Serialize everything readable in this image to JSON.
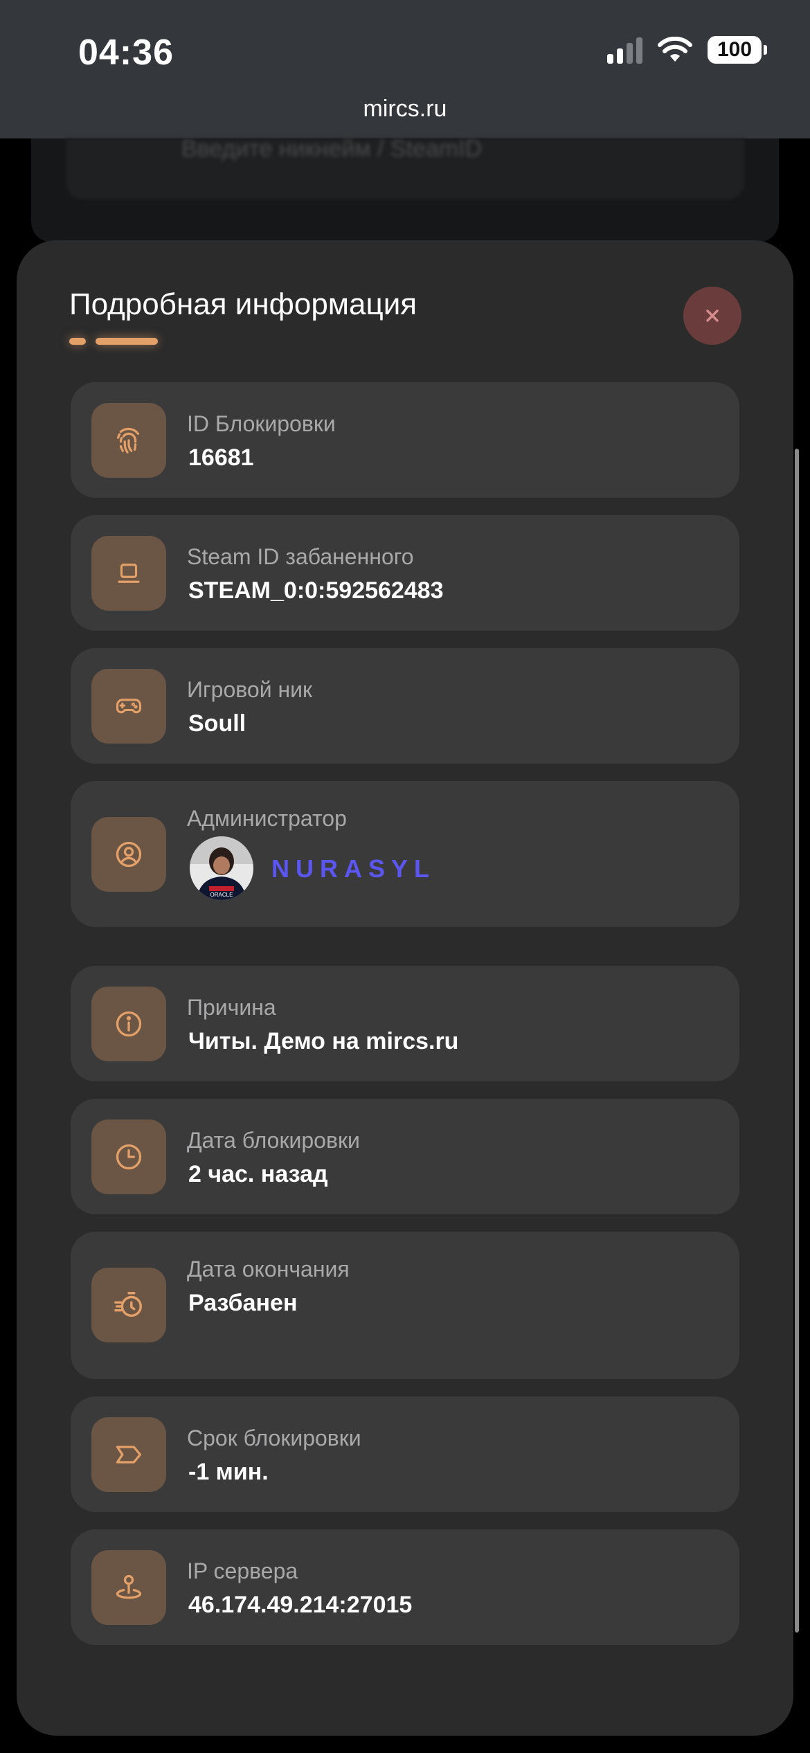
{
  "status_bar": {
    "time": "04:36",
    "battery": "100"
  },
  "browser": {
    "url": "mircs.ru"
  },
  "background": {
    "blurred_text": "Введите никнейм / SteamID"
  },
  "modal": {
    "title": "Подробная информация",
    "close_label": "×",
    "fields": [
      {
        "label": "ID Блокировки",
        "value": "16681",
        "icon": "fingerprint-icon"
      },
      {
        "label": "Steam ID забаненного",
        "value": "STEAM_0:0:592562483",
        "icon": "laptop-icon"
      },
      {
        "label": "Игровой ник",
        "value": "Soull",
        "icon": "gamepad-icon"
      },
      {
        "label": "Администратор",
        "value": "NURASYL",
        "icon": "user-circle-icon"
      },
      {
        "label": "Причина",
        "value": "Читы. Демо на mircs.ru",
        "icon": "info-icon"
      },
      {
        "label": "Дата блокировки",
        "value": "2 час. назад",
        "icon": "clock-icon"
      },
      {
        "label": "Дата окончания",
        "value": "Разбанен",
        "icon": "stopwatch-icon"
      },
      {
        "label": "Срок блокировки",
        "value": "-1 мин.",
        "icon": "tag-arrow-icon"
      },
      {
        "label": "IP сервера",
        "value": "46.174.49.214:27015",
        "icon": "location-pin-icon"
      }
    ]
  },
  "colors": {
    "accent": "#e3a069",
    "admin_name": "#5b56f0",
    "modal_bg": "#2b2b2c",
    "card_bg": "#3a3a3b",
    "icon_bg": "#6b5544",
    "close_bg": "#6a3c3c"
  }
}
